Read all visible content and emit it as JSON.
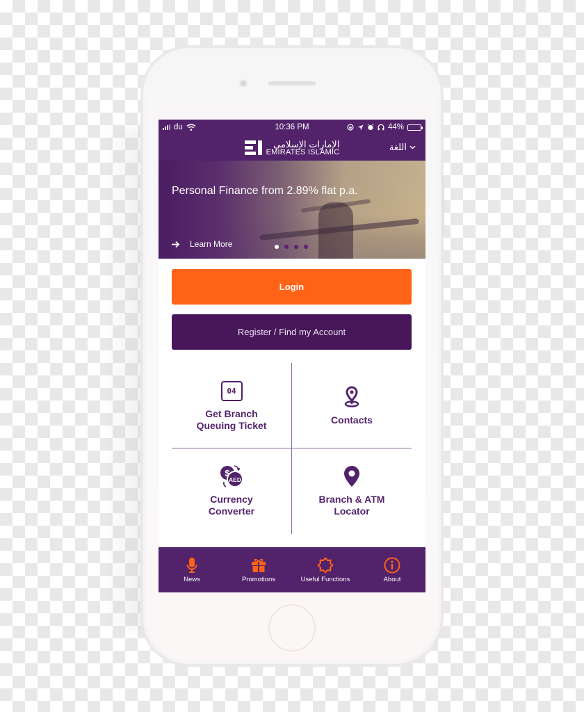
{
  "status_bar": {
    "carrier": "du",
    "time": "10:36 PM",
    "battery_percent": "44%",
    "battery_level": 0.44
  },
  "header": {
    "logo_arabic": "الإمارات الإسلامي",
    "logo_english": "EMIRATES ISLAMIC",
    "language_label": "اللغة"
  },
  "banner": {
    "title": "Personal Finance from 2.89% flat p.a.",
    "link_label": "Learn More",
    "slide_count": 4,
    "active_slide": 1
  },
  "actions": {
    "login_label": "Login",
    "register_label": "Register / Find my Account"
  },
  "tiles": [
    {
      "label_line1": "Get Branch",
      "label_line2": "Queuing Ticket",
      "icon": "queue-ticket-icon",
      "icon_text": "04"
    },
    {
      "label_line1": "Contacts",
      "label_line2": "",
      "icon": "location-pin-outline-icon"
    },
    {
      "label_line1": "Currency",
      "label_line2": "Converter",
      "icon": "currency-exchange-icon",
      "icon_text": "AED"
    },
    {
      "label_line1": "Branch & ATM",
      "label_line2": "Locator",
      "icon": "map-pin-icon"
    }
  ],
  "bottom_nav": [
    {
      "label": "News",
      "icon": "microphone-icon"
    },
    {
      "label": "Promotions",
      "icon": "gift-icon"
    },
    {
      "label": "Useful Functions",
      "icon": "star-badge-icon"
    },
    {
      "label": "About",
      "icon": "info-icon"
    }
  ],
  "colors": {
    "brand_purple": "#52226a",
    "register_purple": "#47175a",
    "accent_orange": "#fe6318",
    "divider": "#8c6a9a"
  }
}
